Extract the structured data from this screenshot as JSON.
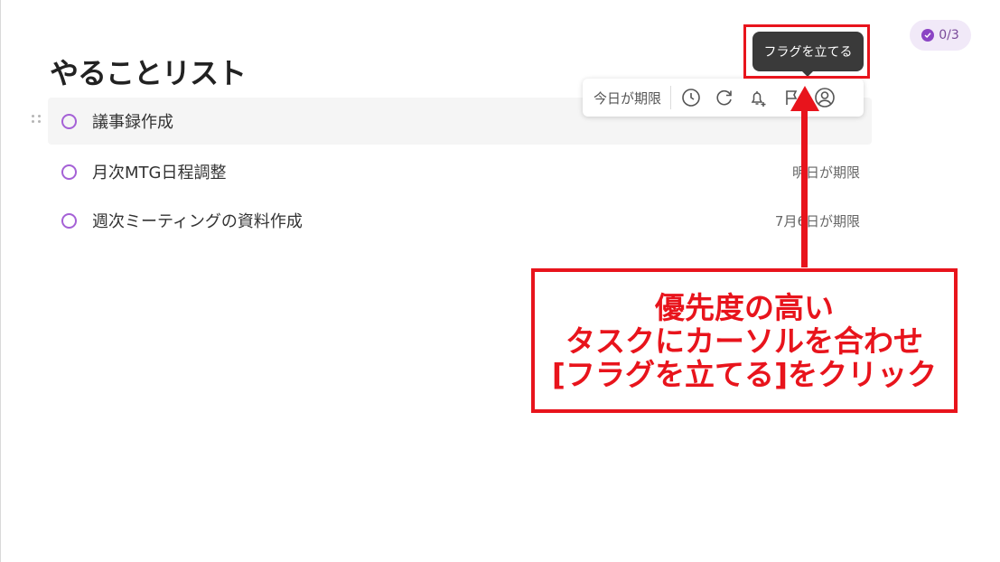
{
  "header": {
    "progress_count": "0/3"
  },
  "page": {
    "title": "やることリスト"
  },
  "tasks": [
    {
      "label": "議事録作成",
      "due": ""
    },
    {
      "label": "月次MTG日程調整",
      "due": "明日が期限"
    },
    {
      "label": "週次ミーティングの資料作成",
      "due": "7月6日が期限"
    }
  ],
  "toolbar": {
    "due_label": "今日が期限",
    "icons": [
      "clock-icon",
      "repeat-icon",
      "bell-plus-icon",
      "flag-icon",
      "user-icon"
    ]
  },
  "tooltip": {
    "text": "フラグを立てる"
  },
  "annotation": {
    "lines": [
      "優先度の高い",
      "タスクにカーソルを合わせ",
      "[フラグを立てる]をクリック"
    ],
    "color": "#e8141c"
  },
  "colors": {
    "accent": "#a561d6",
    "annotation": "#e8141c",
    "badge_bg": "#f1e9f8"
  }
}
